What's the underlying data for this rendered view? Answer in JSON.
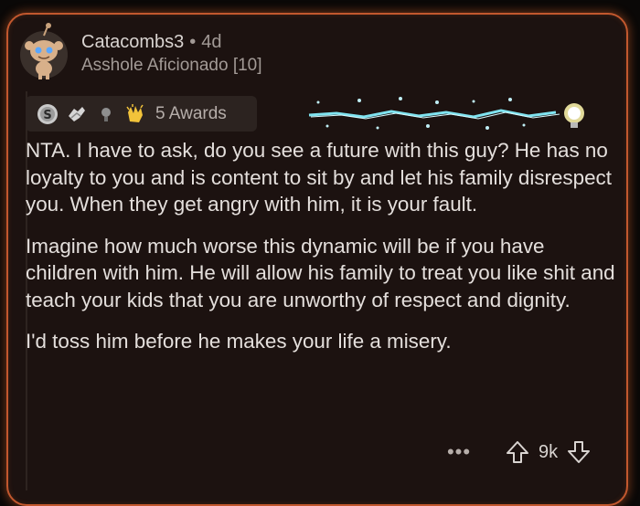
{
  "comment": {
    "username": "Catacombs3",
    "separator": "•",
    "age": "4d",
    "flair": "Asshole Aficionado [10]",
    "awards": {
      "icons": [
        "silver-award-icon",
        "helpful-hands-award-icon",
        "lightbulb-award-icon",
        "clapping-hands-award-icon"
      ],
      "label": "5 Awards"
    },
    "paragraphs": [
      "NTA. I have to ask, do you see a future with this guy? He has no loyalty to you and is content to sit by and let his family disrespect you. When they get angry with him, it is your fault.",
      "Imagine how much worse this dynamic will be if you have children with him. He will allow his family to treat you like shit and teach your kids that you are unworthy of respect and dignity.",
      "I'd toss him before he makes your life a misery."
    ],
    "more_label": "•••",
    "score": "9k"
  },
  "colors": {
    "card_border": "#c2582e",
    "card_background": "#1c1210",
    "text_primary": "#e4dfdc",
    "text_secondary": "#a29a96",
    "lightning": "#7fe3f0"
  }
}
